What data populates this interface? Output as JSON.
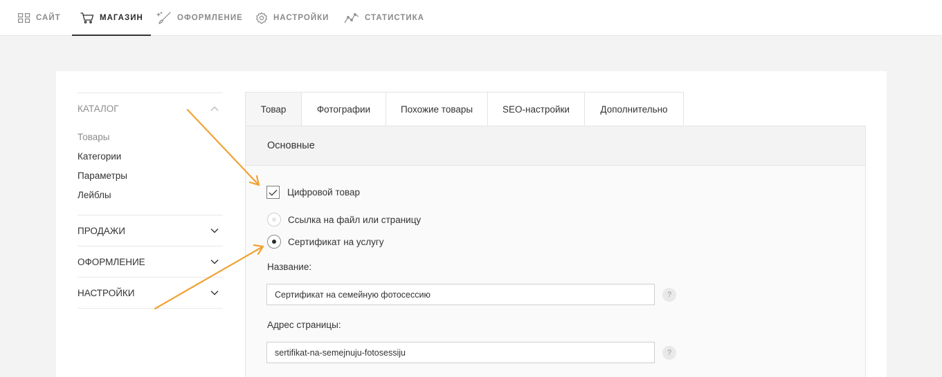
{
  "topnav": {
    "items": [
      {
        "label": "САЙТ",
        "icon": "grid-icon"
      },
      {
        "label": "МАГАЗИН",
        "icon": "cart-icon"
      },
      {
        "label": "ОФОРМЛЕНИЕ",
        "icon": "brush-icon"
      },
      {
        "label": "НАСТРОЙКИ",
        "icon": "gear-icon"
      },
      {
        "label": "СТАТИСТИКА",
        "icon": "chart-icon"
      }
    ],
    "active": "МАГАЗИН"
  },
  "sidebar": {
    "catalog": {
      "title": "КАТАЛОГ",
      "items": [
        "Товары",
        "Категории",
        "Параметры",
        "Лейблы"
      ],
      "active_item": "Товары"
    },
    "sections": [
      "ПРОДАЖИ",
      "ОФОРМЛЕНИЕ",
      "НАСТРОЙКИ"
    ]
  },
  "tabs": {
    "items": [
      "Товар",
      "Фотографии",
      "Похожие товары",
      "SEO-настройки",
      "Дополнительно"
    ],
    "active": "Товар"
  },
  "panel": {
    "title": "Основные",
    "digital_checkbox": {
      "label": "Цифровой товар",
      "checked": true
    },
    "radios": [
      {
        "label": "Ссылка на файл или страницу",
        "checked": false
      },
      {
        "label": "Сертификат на услугу",
        "checked": true
      }
    ],
    "name_field": {
      "label": "Название:",
      "value": "Сертификат на семейную фотосессию"
    },
    "url_field": {
      "label": "Адрес страницы:",
      "value": "sertifikat-na-semejnuju-fotosessiju"
    },
    "help_symbol": "?"
  },
  "colors": {
    "arrow": "#f0a234",
    "text": "#333333",
    "muted": "#8d8d8d"
  }
}
